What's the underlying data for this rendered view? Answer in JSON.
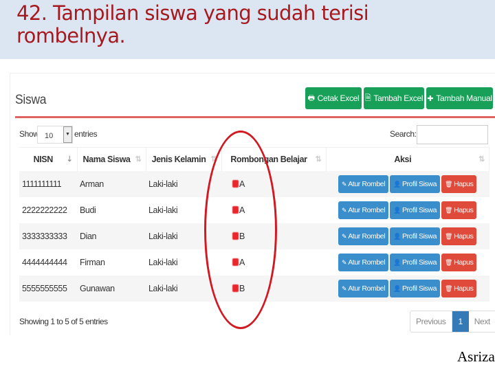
{
  "slide": {
    "title_line1": "42. Tampilan siswa yang sudah terisi",
    "title_line2": "rombelnya.",
    "author": "Asriza",
    "colors": {
      "title": "#a5191f",
      "header_bg": "#dce6f2",
      "highlight_ellipse": "#d01922"
    }
  },
  "panel": {
    "title": "Siswa",
    "buttons": [
      {
        "icon": "print-icon",
        "glyph": "🖶",
        "label": "Cetak Excel"
      },
      {
        "icon": "excel-file-icon",
        "glyph": "🗎",
        "label": "Tambah Excel"
      },
      {
        "icon": "plus-icon",
        "glyph": "✚",
        "label": "Tambah Manual"
      }
    ],
    "colors": {
      "green": "#18a058",
      "rule": "#d9534f",
      "blue": "#3a8ecb",
      "red": "#e04a3a",
      "page_active": "#337ab7"
    }
  },
  "table_controls": {
    "show_label": "Show",
    "page_length": "10",
    "entries_label": "entries",
    "search_label": "Search:",
    "search_value": ""
  },
  "table": {
    "columns": [
      "NISN",
      "Nama Siswa",
      "Jenis Kelamin",
      "Rombongan Belajar",
      "Aksi"
    ],
    "rows": [
      {
        "nisn": "1111111111",
        "nama": "Arman",
        "jk": "Laki-laki",
        "rombel": "A"
      },
      {
        "nisn": "2222222222",
        "nama": "Budi",
        "jk": "Laki-laki",
        "rombel": "A"
      },
      {
        "nisn": "3333333333",
        "nama": "Dian",
        "jk": "Laki-laki",
        "rombel": "B"
      },
      {
        "nisn": "4444444444",
        "nama": "Firman",
        "jk": "Laki-laki",
        "rombel": "A"
      },
      {
        "nisn": "5555555555",
        "nama": "Gunawan",
        "jk": "Laki-laki",
        "rombel": "B"
      }
    ],
    "actions": {
      "atur": {
        "icon": "edit-icon",
        "glyph": "✎",
        "label": "Atur Rombel"
      },
      "profil": {
        "icon": "user-icon",
        "glyph": "👤",
        "label": "Profil Siswa"
      },
      "hapus": {
        "icon": "trash-icon",
        "glyph": "🗑",
        "label": "Hapus"
      }
    },
    "sort_glyph": "⇅",
    "sort_active_glyph": "⇣"
  },
  "footer": {
    "info": "Showing 1 to 5 of 5 entries",
    "pagination": {
      "previous": "Previous",
      "current": "1",
      "next": "Next"
    }
  }
}
